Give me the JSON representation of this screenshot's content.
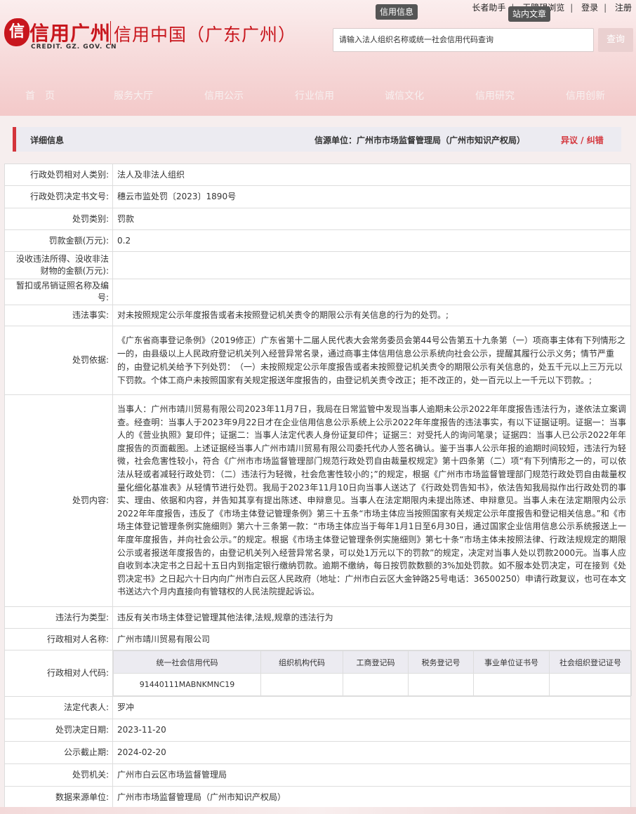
{
  "header": {
    "top_links": [
      "长者助手",
      "无障碍浏览",
      "登录",
      "注册"
    ],
    "tip_info": "信用信息",
    "tip_site": "站内文章",
    "logo_mark": "信",
    "logo_text": "信用广州",
    "logo_sub": "CREDIT. GZ. GOV. CN",
    "logo_title": "信用中国（广东广州）",
    "search_placeholder": "请输入法人组织名称或统一社会信用代码查询",
    "search_button": "查询",
    "nav": [
      "首　页",
      "服务大厅",
      "信用公示",
      "行业信用",
      "诚信文化",
      "信用研究",
      "信用创新"
    ]
  },
  "detail": {
    "title": "详细信息",
    "source": "信源单位：广州市市场监督管理局（广州市知识产权局）",
    "dispute": "异议 / 纠错"
  },
  "rows": {
    "counterpart_type": {
      "label": "行政处罚相对人类别:",
      "value": "法人及非法人组织"
    },
    "doc_no": {
      "label": "行政处罚决定书文号:",
      "value": "穗云市监处罚〔2023〕1890号"
    },
    "penalty_type": {
      "label": "处罚类别:",
      "value": "罚款"
    },
    "fine": {
      "label": "罚款金额(万元):",
      "value": "0.2"
    },
    "confiscation": {
      "label": "没收违法所得、没收非法财物的金额(万元):",
      "value": ""
    },
    "license": {
      "label": "暂扣或吊销证照名称及编号:",
      "value": ""
    },
    "facts": {
      "label": "违法事实:",
      "value": "对未按照规定公示年度报告或者未按照登记机关责令的期限公示有关信息的行为的处罚。;"
    },
    "basis": {
      "label": "处罚依据:",
      "value": "《广东省商事登记条例》（2019修正）广东省第十二届人民代表大会常务委员会第44号公告第五十九条第（一）项商事主体有下列情形之一的，由县级以上人民政府登记机关列入经营异常名录，通过商事主体信用信息公示系统向社会公示，提醒其履行公示义务；情节严重的，由登记机关给予下列处罚：　（一）未按照规定公示年度报告或者未按照登记机关责令的期限公示有关信息的，处五千元以上三万元以下罚款。个体工商户未按照国家有关规定报送年度报告的，由登记机关责令改正；拒不改正的，处一百元以上一千元以下罚款。;"
    },
    "content": {
      "label": "处罚内容:",
      "value": "当事人：广州市靖川贸易有限公司2023年11月7日，我局在日常监管中发现当事人逾期未公示2022年年度报告违法行为，遂依法立案调查。经查明：当事人于2023年9月22日才在企业信用信息公示系统上公示2022年年度报告的违法事实，有以下证据证明。证据一：当事人的《营业执照》复印件；证据二：当事人法定代表人身份证复印件；证据三：对受托人的询问笔录；证据四：当事人已公示2022年年度报告的页面截图。上述证据经当事人广州市靖川贸易有限公司委托代办人签名确认。鉴于当事人公示年报的逾期时间较短，违法行为轻微，社会危害性较小，符合《广州市市场监督管理部门规范行政处罚自由裁量权规定》第十四条第（二）项“有下列情形之一的，可以依法从轻或者减轻行政处罚：（二）违法行为轻微，社会危害性较小的；”的规定，根据《广州市市场监督管理部门规范行政处罚自由裁量权量化细化基准表》从轻情节进行处罚。我局于2023年11月10日向当事人送达了《行政处罚告知书》，依法告知我局拟作出行政处罚的事实、理由、依据和内容，并告知其享有提出陈述、申辩意见。当事人在法定期限内未提出陈述、申辩意见。当事人未在法定期限内公示2022年年度报告，违反了《市场主体登记管理条例》第三十五条“市场主体应当按照国家有关规定公示年度报告和登记相关信息。”和《市场主体登记管理条例实施细则》第六十三条第一款：“市场主体应当于每年1月1日至6月30日，通过国家企业信用信息公示系统报送上一年度年度报告，并向社会公示。”的规定。根据《市场主体登记管理条例实施细则》第七十条“市场主体未按照法律、行政法规规定的期限公示或者报送年度报告的，由登记机关列入经营异常名录，可以处1万元以下的罚款”的规定，决定对当事人处以罚款2000元。当事人应自收到本决定书之日起十五日内到指定银行缴纳罚款。逾期不缴纳，每日按罚款数额的3%加处罚款。如不服本处罚决定，可在接到《处罚决定书》之日起六十日内向广州市白云区人民政府（地址：广州市白云区大金钟路25号电话：36500250）申请行政复议，也可在本文书送达六个月内直接向有管辖权的人民法院提起诉讼。"
    },
    "violation_type": {
      "label": "违法行为类型:",
      "value": "违反有关市场主体登记管理其他法律,法规,规章的违法行为"
    },
    "counterpart_name": {
      "label": "行政相对人名称:",
      "value": "广州市靖川贸易有限公司"
    },
    "counterpart_code": {
      "label": "行政相对人代码:",
      "headers": [
        "统一社会信用代码",
        "组织机构代码",
        "工商登记码",
        "税务登记号",
        "事业单位证书号",
        "社会组织登记证号"
      ],
      "values": [
        "91440111MABNKMNC19",
        "",
        "",
        "",
        "",
        ""
      ]
    },
    "legal_rep": {
      "label": "法定代表人:",
      "value": "罗冲"
    },
    "decision_date": {
      "label": "处罚决定日期:",
      "value": "2023-11-20"
    },
    "deadline": {
      "label": "公示截止期:",
      "value": "2024-02-20"
    },
    "authority": {
      "label": "处罚机关:",
      "value": "广州市白云区市场监督管理局"
    },
    "data_source": {
      "label": "数据来源单位:",
      "value": "广州市市场监督管理局（广州市知识产权局）"
    }
  }
}
